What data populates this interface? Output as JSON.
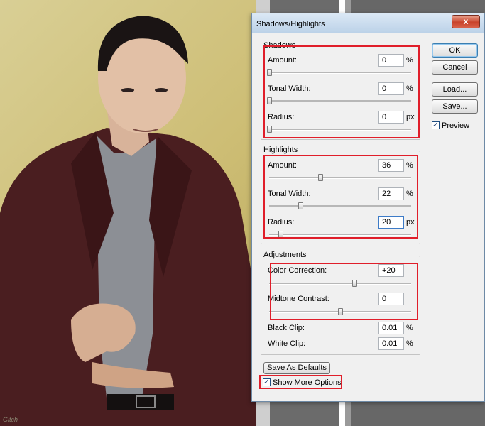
{
  "dialog": {
    "title": "Shadows/Highlights",
    "close_glyph": "x",
    "buttons": {
      "ok": "OK",
      "cancel": "Cancel",
      "load": "Load...",
      "save": "Save..."
    },
    "preview": {
      "label": "Preview",
      "checked": true
    },
    "shadows": {
      "legend": "Shadows",
      "amount": {
        "label": "Amount:",
        "value": "0",
        "unit": "%",
        "level": 0
      },
      "tonal_width": {
        "label": "Tonal Width:",
        "value": "0",
        "unit": "%",
        "level": 0
      },
      "radius": {
        "label": "Radius:",
        "value": "0",
        "unit": "px",
        "level": 0
      }
    },
    "highlights": {
      "legend": "Highlights",
      "amount": {
        "label": "Amount:",
        "value": "36",
        "unit": "%",
        "level": 0.36
      },
      "tonal_width": {
        "label": "Tonal Width:",
        "value": "22",
        "unit": "%",
        "level": 0.22
      },
      "radius": {
        "label": "Radius:",
        "value": "20",
        "unit": "px",
        "level": 0.08
      }
    },
    "adjustments": {
      "legend": "Adjustments",
      "color_correction": {
        "label": "Color Correction:",
        "value": "+20",
        "level": 0.6
      },
      "midtone_contrast": {
        "label": "Midtone Contrast:",
        "value": "0",
        "level": 0.5
      },
      "black_clip": {
        "label": "Black Clip:",
        "value": "0.01",
        "unit": "%"
      },
      "white_clip": {
        "label": "White Clip:",
        "value": "0.01",
        "unit": "%"
      }
    },
    "save_defaults": "Save As Defaults",
    "show_more_options": {
      "label": "Show More Options",
      "checked": true
    }
  },
  "watermark": "Gitch",
  "colors": {
    "annotation_red": "#e01e2a",
    "suit": "#4a1e20",
    "backdrop": "#d4c682"
  }
}
